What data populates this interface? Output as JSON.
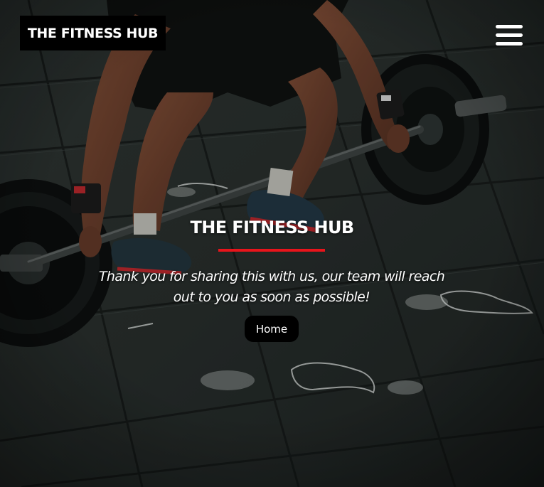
{
  "header": {
    "logo_text": "THE FITNESS HUB",
    "menu_icon": "hamburger-menu-icon"
  },
  "main": {
    "title": "THE FITNESS HUB",
    "message": "Thank you for sharing this with us, our team will reach out to you as soon as possible!",
    "home_button_label": "Home"
  },
  "colors": {
    "accent": "#e8141b",
    "logo_background": "#000000",
    "button_background": "#000000",
    "text": "#ffffff",
    "floor": "#2a302e"
  },
  "background_image": "weightlifter-deadlift-barbell-gym-floor"
}
